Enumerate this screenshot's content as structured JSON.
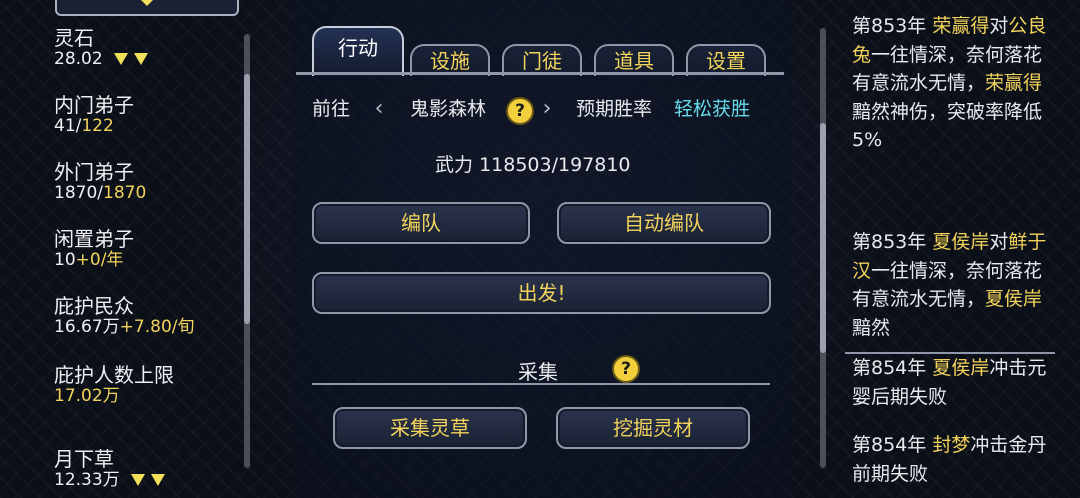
{
  "resources": [
    {
      "label": "灵石",
      "value": "28.02",
      "value_alt": "",
      "arrows": true
    },
    {
      "label": "内门弟子",
      "value": "41/",
      "value_alt": "122",
      "arrows": false
    },
    {
      "label": "外门弟子",
      "value": "1870/",
      "value_alt": "1870",
      "arrows": false
    },
    {
      "label": "闲置弟子",
      "value": "10",
      "value_alt": "+0/年",
      "arrows": false
    },
    {
      "label": "庇护民众",
      "value": "16.67万",
      "value_alt": "+7.80/旬",
      "arrows": false
    },
    {
      "label": "庇护人数上限",
      "value": "",
      "value_alt": "17.02万",
      "arrows": false
    },
    {
      "label": "月下草",
      "value": "12.33万",
      "value_alt": "",
      "arrows": true
    }
  ],
  "tabs": [
    "行动",
    "设施",
    "门徒",
    "道具",
    "设置"
  ],
  "action": {
    "goto_label": "前往",
    "location": "鬼影森林",
    "win_rate_label": "预期胜率",
    "win_rate_value": "轻松获胜",
    "force_label": "武力",
    "force_value": "118503/197810",
    "formation_button": "编队",
    "auto_formation_button": "自动编队",
    "depart_button": "出发!",
    "gather_title": "采集",
    "gather_herb_button": "采集灵草",
    "dig_material_button": "挖掘灵材"
  },
  "log": {
    "entry1": {
      "year": "第853年",
      "a": "荣赢得",
      "t1": "对",
      "b": "公良兔",
      "t2": "一往情深，奈何落花有意流水无情，",
      "c": "荣赢得",
      "t3": "黯然神伤，突破率降低5%"
    },
    "entry2": {
      "year": "第853年",
      "a": "夏侯岸",
      "t1": "对",
      "b": "鲜于汉",
      "t2": "一往情深，奈何落花有意流水无情，",
      "c": "夏侯岸",
      "t3": "黯然"
    },
    "entry3": {
      "year": "第854年",
      "a": "夏侯岸",
      "t1": "冲击元婴后期失败"
    },
    "entry4": {
      "year": "第854年",
      "a": "封梦",
      "t1": "冲击金丹前期失败"
    }
  },
  "colors": {
    "accent_yellow": "#f2d35b",
    "highlight_cyan": "#66d9e8"
  }
}
